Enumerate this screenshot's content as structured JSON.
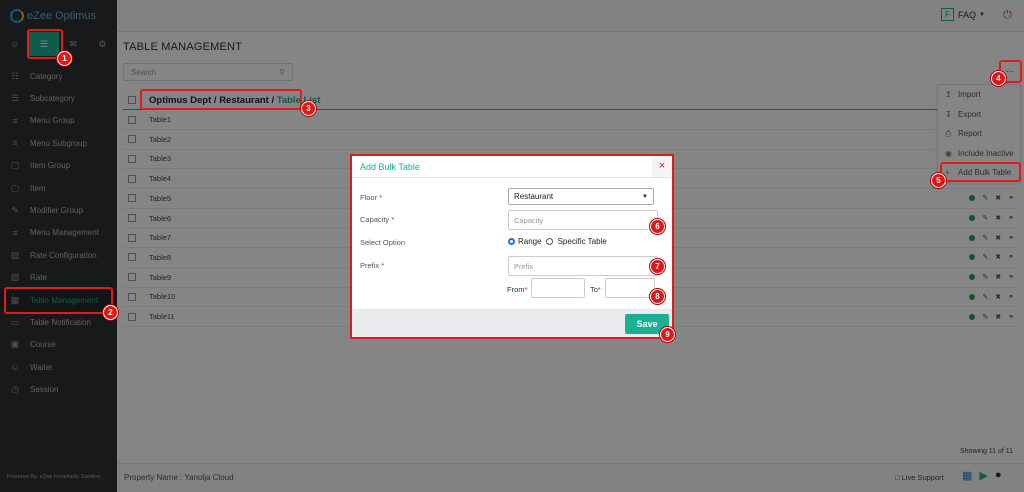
{
  "app": {
    "name": "eZee Optimus",
    "powered_by": "Powered By: eZee Hospitality Solution"
  },
  "sidebar": {
    "top_icons": [
      "user-icon",
      "menu-icon",
      "megaphone-icon",
      "gear-icon"
    ],
    "items": [
      {
        "label": "Category",
        "icon": "category-icon"
      },
      {
        "label": "Subcategory",
        "icon": "subcategory-icon"
      },
      {
        "label": "Menu Group",
        "icon": "list-icon"
      },
      {
        "label": "Menu Subgroup",
        "icon": "list-icon"
      },
      {
        "label": "Item Group",
        "icon": "box-icon"
      },
      {
        "label": "Item",
        "icon": "box-icon"
      },
      {
        "label": "Modifier Group",
        "icon": "edit-icon"
      },
      {
        "label": "Menu Management",
        "icon": "list-icon"
      },
      {
        "label": "Rate Configuration",
        "icon": "rate-icon"
      },
      {
        "label": "Rate",
        "icon": "rate-icon"
      },
      {
        "label": "Table Management",
        "icon": "grid-icon"
      },
      {
        "label": "Table Notification",
        "icon": "chat-icon"
      },
      {
        "label": "Course",
        "icon": "course-icon"
      },
      {
        "label": "Waiter",
        "icon": "person-icon"
      },
      {
        "label": "Session",
        "icon": "clock-icon"
      }
    ]
  },
  "header": {
    "faq_badge": "F",
    "faq_label": "FAQ",
    "power_icon": "power-icon"
  },
  "page": {
    "title": "TABLE MANAGEMENT",
    "search_placeholder": "Search",
    "breadcrumb": {
      "part1": "Optimus Dept / Restaurant /",
      "part2": "Table List"
    },
    "rows": [
      "Table1",
      "Table2",
      "Table3",
      "Table4",
      "Table5",
      "Table6",
      "Table7",
      "Table8",
      "Table9",
      "Table10",
      "Table11"
    ],
    "showing": "Showing 11 of 11"
  },
  "dropdown": {
    "more_label": "...",
    "items": [
      {
        "label": "Import",
        "icon": "import-icon"
      },
      {
        "label": "Export",
        "icon": "export-icon"
      },
      {
        "label": "Report",
        "icon": "print-icon"
      },
      {
        "label": "Include Inactive",
        "icon": "eye-icon"
      },
      {
        "label": "Add Bulk Table",
        "icon": "plus-icon"
      }
    ]
  },
  "modal": {
    "title": "Add Bulk Table",
    "close": "×",
    "floor_label": "Floor",
    "floor_value": "Restaurant",
    "capacity_label": "Capacity",
    "capacity_placeholder": "Capacity",
    "select_option_label": "Select Option",
    "option_range": "Range",
    "option_specific": "Specific Table",
    "prefix_label": "Prefix",
    "prefix_placeholder": "Prefix",
    "from_label": "From",
    "to_label": "To",
    "required_mark": "*",
    "save": "Save"
  },
  "footer": {
    "property": "Property Name : Yanolja Cloud",
    "live_support": "Live Support"
  },
  "annotations": [
    "1",
    "2",
    "3",
    "4",
    "5",
    "6",
    "7",
    "8",
    "9"
  ],
  "colors": {
    "accent": "#19b093",
    "annotation": "#e01b1b",
    "sidebar": "#2d3035"
  }
}
